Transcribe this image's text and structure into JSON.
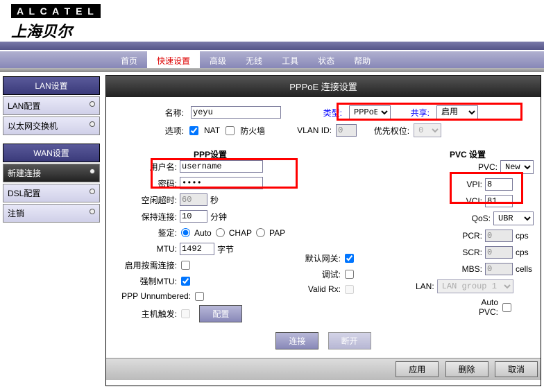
{
  "brand": {
    "en": "A L C A T E L",
    "cn": "上海贝尔"
  },
  "nav": {
    "items": [
      "首页",
      "快速设置",
      "高级",
      "无线",
      "工具",
      "状态",
      "帮助"
    ],
    "activeIndex": 1
  },
  "sidebar": {
    "lan_head": "LAN设置",
    "lan_items": [
      "LAN配置",
      "以太网交换机"
    ],
    "wan_head": "WAN设置",
    "wan_items": [
      "新建连接",
      "DSL配置",
      "注销"
    ],
    "wan_active": 0
  },
  "page": {
    "title": "PPPoE 连接设置",
    "name_lbl": "名称:",
    "name_val": "yeyu",
    "options_lbl": "选项:",
    "nat": "NAT",
    "firewall": "防火墙",
    "nat_checked": true,
    "fw_checked": false,
    "type_lbl": "类型:",
    "type_val": "PPPoE",
    "share_lbl": "共享:",
    "share_val": "启用",
    "vlan_lbl": "VLAN ID:",
    "vlan_val": "0",
    "prio_lbl": "优先权位:",
    "prio_val": "0",
    "ppp_head": "PPP设置",
    "user_lbl": "用户名:",
    "user_val": "username",
    "pass_lbl": "密码:",
    "pass_val": "●●●●",
    "idle_lbl": "空闲超时:",
    "idle_val": "60",
    "idle_unit": "秒",
    "keep_lbl": "保持连接:",
    "keep_val": "10",
    "keep_unit": "分钟",
    "auth_lbl": "鉴定:",
    "auth_auto": "Auto",
    "auth_chap": "CHAP",
    "auth_pap": "PAP",
    "mtu_lbl": "MTU:",
    "mtu_val": "1492",
    "mtu_unit": "字节",
    "ondemand_lbl": "启用按需连接:",
    "defgw_lbl": "默认网关:",
    "defgw_checked": true,
    "forcemtu_lbl": "强制MTU:",
    "forcemtu_checked": true,
    "debug_lbl": "调试:",
    "unnum_lbl": "PPP Unnumbered:",
    "validrx_lbl": "Valid Rx:",
    "lan_lbl": "LAN:",
    "lan_val": "LAN group 1",
    "hosttrig_lbl": "主机触发:",
    "config_btn": "配置",
    "pvc_head": "PVC 设置",
    "pvc_lbl": "PVC:",
    "pvc_val": "New",
    "vpi_lbl": "VPI:",
    "vpi_val": "8",
    "vci_lbl": "VCI:",
    "vci_val": "81",
    "qos_lbl": "QoS:",
    "qos_val": "UBR",
    "pcr_lbl": "PCR:",
    "pcr_val": "0",
    "cps": "cps",
    "scr_lbl": "SCR:",
    "scr_val": "0",
    "mbs_lbl": "MBS:",
    "mbs_val": "0",
    "cells": "cells",
    "autopvc_lbl": "Auto\nPVC:",
    "connect_btn": "连接",
    "disconnect_btn": "断开"
  },
  "footer": {
    "apply": "应用",
    "delete": "删除",
    "cancel": "取消"
  }
}
